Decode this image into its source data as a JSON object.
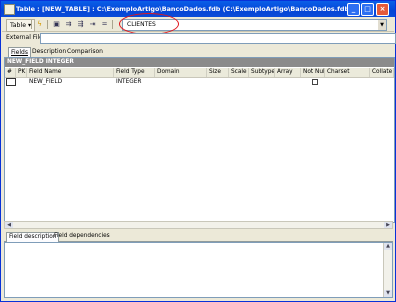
{
  "window": {
    "title": "Table : [NEW_TABLE] : C:\\ExemploArtigo\\BancoDados.fdb (C:\\ExemploArtigo\\BancoDados.fdb)",
    "buttons": {
      "minimize": "_",
      "maximize": "□",
      "close": "×"
    }
  },
  "toolbar": {
    "table_menu": "Table",
    "table_name": "CLIENTES",
    "icons": [
      "compile-icon",
      "save-icon",
      "add-field-icon",
      "insert-field-icon",
      "delete-field-icon",
      "move-icon"
    ]
  },
  "external_file": {
    "label": "External File",
    "value": ""
  },
  "tabs": [
    {
      "label": "Fields",
      "active": true
    },
    {
      "label": "Description",
      "active": false
    },
    {
      "label": "Comparison",
      "active": false
    }
  ],
  "grid": {
    "group_header": "NEW_FIELD INTEGER",
    "columns": [
      "#",
      "PK",
      "Field Name",
      "Field Type",
      "Domain",
      "Size",
      "Scale",
      "Subtype",
      "Array",
      "Not Null",
      "Charset",
      "Collate"
    ],
    "rows": [
      {
        "num": "",
        "pk": "",
        "name": "NEW_FIELD",
        "type": "INTEGER",
        "domain": "",
        "size": "",
        "scale": "",
        "subtype": "",
        "array": "",
        "not_null": false,
        "charset": "",
        "collate": ""
      }
    ]
  },
  "bottom_tabs": [
    {
      "label": "Field description",
      "active": true
    },
    {
      "label": "Field dependencies",
      "active": false
    }
  ]
}
